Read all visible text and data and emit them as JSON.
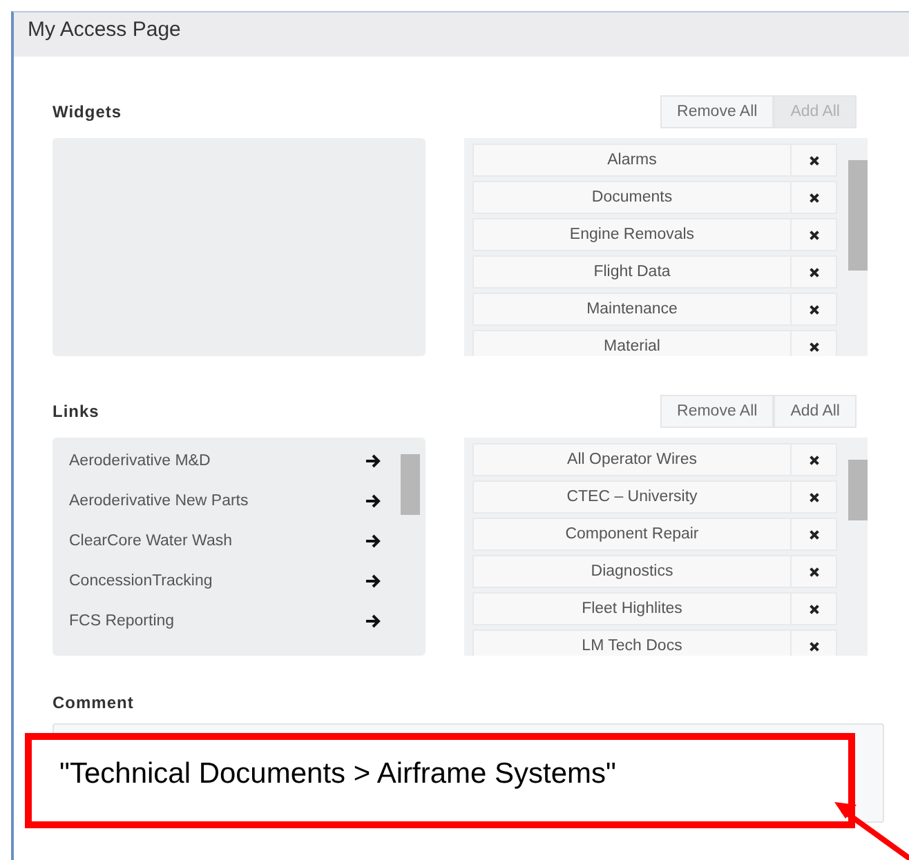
{
  "window": {
    "title": "My Access Page"
  },
  "sections": [
    {
      "heading": "Widgets",
      "buttons": [
        {
          "label": "Remove All",
          "disabled": false
        },
        {
          "label": "Add All",
          "disabled": true
        }
      ],
      "selected_items": [
        "Alarms",
        "Documents",
        "Engine Removals",
        "Flight Data",
        "Maintenance",
        "Material"
      ]
    },
    {
      "heading": "Links",
      "buttons": [
        {
          "label": "Remove All",
          "disabled": false
        },
        {
          "label": "Add All",
          "disabled": false
        }
      ],
      "available": [
        "Aeroderivative M&D",
        "Aeroderivative New Parts",
        "ClearCore Water Wash",
        "ConcessionTracking",
        "FCS Reporting"
      ],
      "selected_items": [
        "All Operator Wires",
        "CTEC – University",
        "Component Repair",
        "Diagnostics",
        "Fleet Highlites",
        "LM Tech Docs"
      ]
    }
  ],
  "comment": {
    "label": "Comment"
  },
  "annotation": {
    "text": "\"Technical Documents > Airframe Systems\""
  }
}
